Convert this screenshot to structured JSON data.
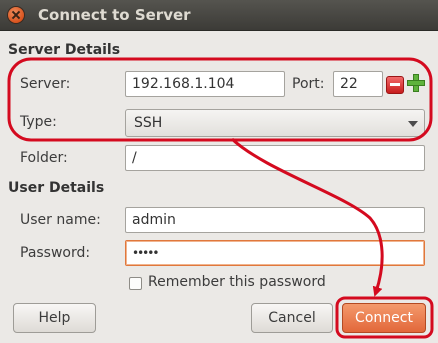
{
  "window": {
    "title": "Connect to Server"
  },
  "server_details": {
    "heading": "Server Details",
    "server_label": "Server:",
    "server_value": "192.168.1.104",
    "port_label": "Port:",
    "port_value": "22",
    "type_label": "Type:",
    "type_value": "SSH",
    "folder_label": "Folder:",
    "folder_value": "/"
  },
  "user_details": {
    "heading": "User Details",
    "username_label": "User name:",
    "username_value": "admin",
    "password_label": "Password:",
    "password_value": "•••••",
    "remember_label": "Remember this password"
  },
  "buttons": {
    "help": "Help",
    "cancel": "Cancel",
    "connect": "Connect"
  },
  "colors": {
    "annotation": "#d40a1f",
    "accent": "#e2673a"
  }
}
